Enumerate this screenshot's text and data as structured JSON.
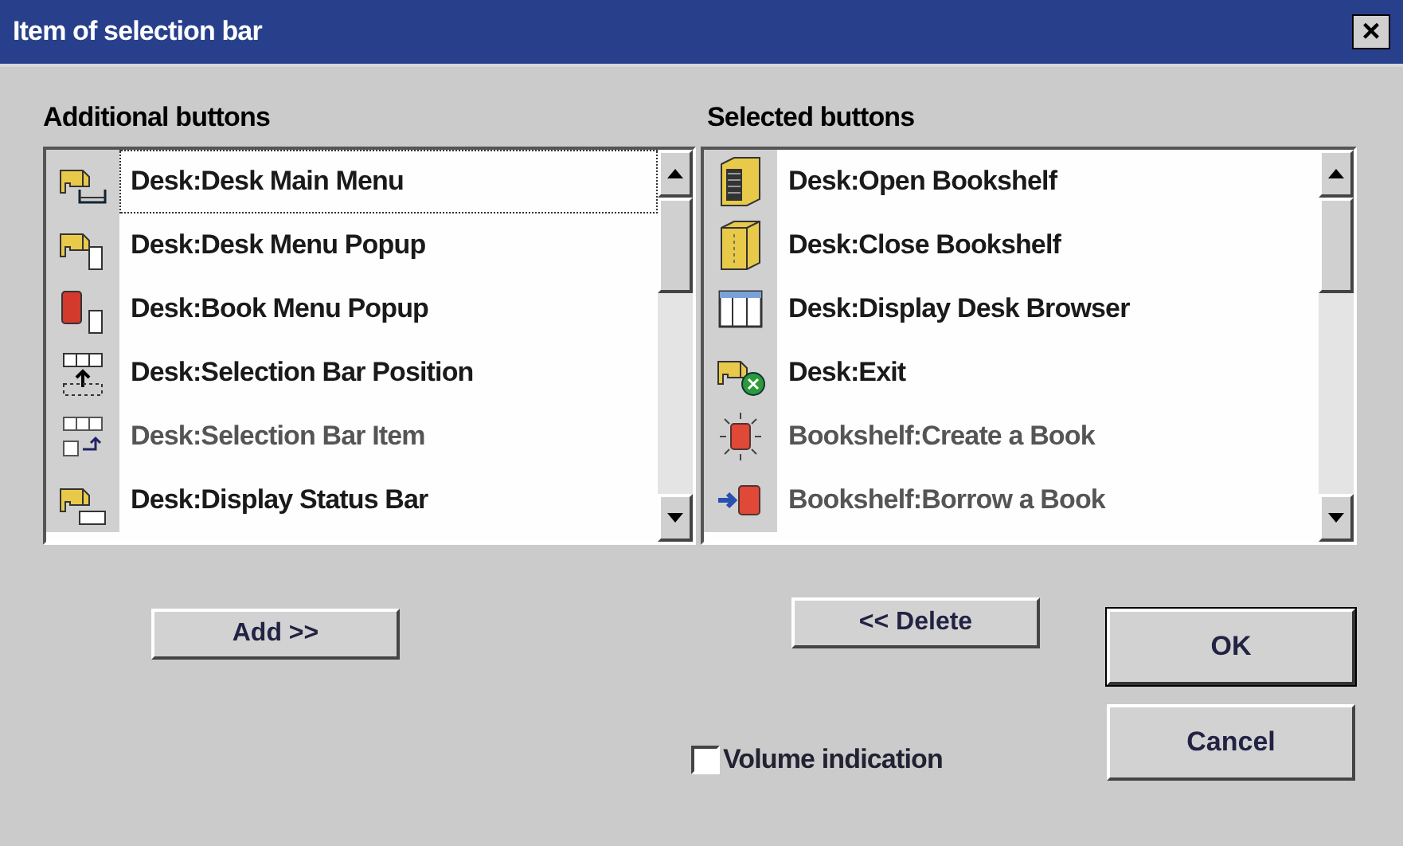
{
  "window": {
    "title": "Item of selection bar",
    "close_label": "×"
  },
  "additional": {
    "label": "Additional buttons",
    "items": [
      {
        "text": "Desk:Desk Main Menu",
        "kind": "desk-menu",
        "selected": true,
        "disabled": false
      },
      {
        "text": "Desk:Desk Menu Popup",
        "kind": "desk-popup",
        "selected": false,
        "disabled": false
      },
      {
        "text": "Desk:Book Menu Popup",
        "kind": "book-popup",
        "selected": false,
        "disabled": false
      },
      {
        "text": "Desk:Selection Bar Position",
        "kind": "bar-position",
        "selected": false,
        "disabled": false
      },
      {
        "text": "Desk:Selection Bar Item",
        "kind": "bar-item",
        "selected": false,
        "disabled": true
      },
      {
        "text": "Desk:Display Status Bar",
        "kind": "status-bar",
        "selected": false,
        "disabled": false
      }
    ]
  },
  "selected_buttons": {
    "label": "Selected buttons",
    "items": [
      {
        "text": "Desk:Open Bookshelf",
        "kind": "open-shelf",
        "selected": false,
        "disabled": false
      },
      {
        "text": "Desk:Close Bookshelf",
        "kind": "close-shelf",
        "selected": false,
        "disabled": false
      },
      {
        "text": "Desk:Display Desk Browser",
        "kind": "browser",
        "selected": false,
        "disabled": false
      },
      {
        "text": "Desk:Exit",
        "kind": "exit",
        "selected": false,
        "disabled": false
      },
      {
        "text": "Bookshelf:Create a Book",
        "kind": "create-book",
        "selected": false,
        "disabled": true
      },
      {
        "text": "Bookshelf:Borrow a Book",
        "kind": "borrow-book",
        "selected": false,
        "disabled": true
      }
    ]
  },
  "add_button": "Add >>",
  "delete_button": "<< Delete",
  "volume_indication": {
    "label": "Volume indication",
    "checked": false
  },
  "ok_button": "OK",
  "cancel_button": "Cancel"
}
